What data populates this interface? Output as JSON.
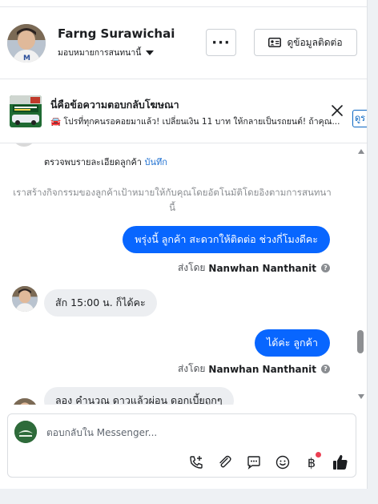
{
  "header": {
    "customer_name": "Farng Surawichai",
    "assign_label": "มอบหมายการสนทนานี้",
    "more_label": "···",
    "contact_button_label": "ดูข้อมูลติดต่อ"
  },
  "ad_banner": {
    "title": "นี่คือข้อความตอบกลับโฆษณา",
    "text": "🚘 โปรที่ทุกคนรอคอยมาแล้ว! เปลี่ยนเงิน 11 บาท ให้กลายเป็นรถยนต์! ถ้าคุณ...",
    "link_label": "ดูร"
  },
  "chat": {
    "review_text": "ตรวจพบรายละเอียดลูกค้า",
    "review_link": "บันทึก",
    "system_message": "เราสร้างกิจกรรมของลูกค้าเป้าหมายให้กับคุณโดยอัตโนมัติโดยอิงตามการสนทนานี้",
    "messages": [
      {
        "direction": "out",
        "text": "พรุ่งนี้ ลูกค้า สะดวกให้ติดต่อ ช่วงกี่โมงดีคะ"
      },
      {
        "direction": "in",
        "text": "สัก 15:00 น. ก็ได้คะ"
      },
      {
        "direction": "out",
        "text": "ได้ค่ะ  ลูกค้า"
      },
      {
        "direction": "in",
        "text": "ลอง คำนวณ ดาวแล้วผ่อน ดอกเบี้ยถูกๆ"
      }
    ],
    "sent_by_prefix": "ส่งโดย",
    "sent_by_name": "Nanwhan Nanthanit"
  },
  "composer": {
    "placeholder": "ตอบกลับใน Messenger..."
  },
  "colors": {
    "outgoing_bubble": "#0866ff",
    "incoming_bubble": "#eceef1",
    "link": "#1d6fd1",
    "notification_dot": "#ec3f53"
  },
  "icons": [
    "more-icon",
    "contact-card-icon",
    "close-icon",
    "call-add-icon",
    "attachment-icon",
    "saved-reply-icon",
    "emoji-icon",
    "baht-icon",
    "thumbs-up-icon",
    "help-icon"
  ]
}
